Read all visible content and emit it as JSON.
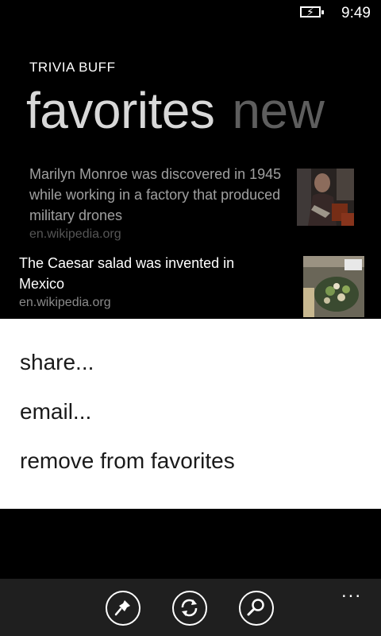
{
  "status_bar": {
    "time": "9:49",
    "battery_icon": "battery-charging-icon"
  },
  "app": {
    "title": "TRIVIA BUFF"
  },
  "pivot": {
    "active": "favorites",
    "inactive": "new"
  },
  "items": [
    {
      "text": "Marilyn Monroe was discovered in 1945 while working in a factory that produced military drones",
      "source": "en.wikipedia.org",
      "thumbnail": "portrait-photo"
    },
    {
      "text": "The Caesar salad was invented in Mexico",
      "source": "en.wikipedia.org",
      "thumbnail": "salad-photo"
    }
  ],
  "context_menu": [
    "share...",
    "email...",
    "remove from favorites"
  ],
  "app_bar": {
    "buttons": [
      "pin-icon",
      "refresh-icon",
      "search-icon"
    ],
    "more": "..."
  },
  "colors": {
    "background": "#000000",
    "menu_bg": "#ffffff",
    "app_bar_bg": "#1f1f1f",
    "inactive_pivot": "#5e5e5e",
    "source_text": "#8a8a8a"
  }
}
